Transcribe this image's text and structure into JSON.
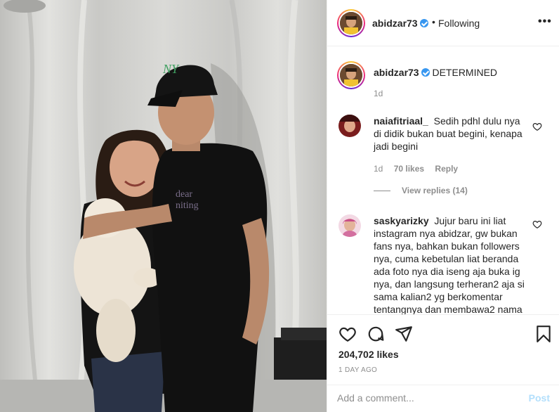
{
  "post": {
    "author": "abidzar73",
    "separator": "•",
    "follow_state": "Following",
    "more_label": "•••",
    "caption_author": "abidzar73",
    "caption_text": "DETERMINED",
    "caption_age": "1d",
    "likes": "204,702 likes",
    "time_ago": "1 DAY AGO",
    "photo_shirt_text": "dear\nvaling"
  },
  "comments": [
    {
      "username": "naiafitriaal_",
      "text": "Sedih pdhl dulu nya di didik bukan buat begini, kenapa jadi begini",
      "age": "1d",
      "likes": "70 likes",
      "reply": "Reply",
      "view_replies": "View replies (14)"
    },
    {
      "username": "saskyarizky",
      "text": "Jujur baru ini liat instagram nya abidzar, gw bukan fans nya, bahkan bukan followers nya, cuma kebetulan liat beranda ada foto nya dia iseng aja buka ig nya, dan langsung terheran2 aja si sama kalian2 yg berkomentar tentangnya dan membawa2 nama"
    }
  ],
  "icons": {
    "like": "heart-icon",
    "comment": "comment-bubble-icon",
    "share": "paper-plane-icon",
    "save": "bookmark-icon",
    "more": "more-options-icon",
    "verified": "verified-badge-icon"
  },
  "comment_box": {
    "placeholder": "Add a comment...",
    "post_label": "Post"
  },
  "colors": {
    "verified": "#3897f0",
    "post_disabled": "#b2dffc",
    "muted": "#8e8e8e"
  }
}
